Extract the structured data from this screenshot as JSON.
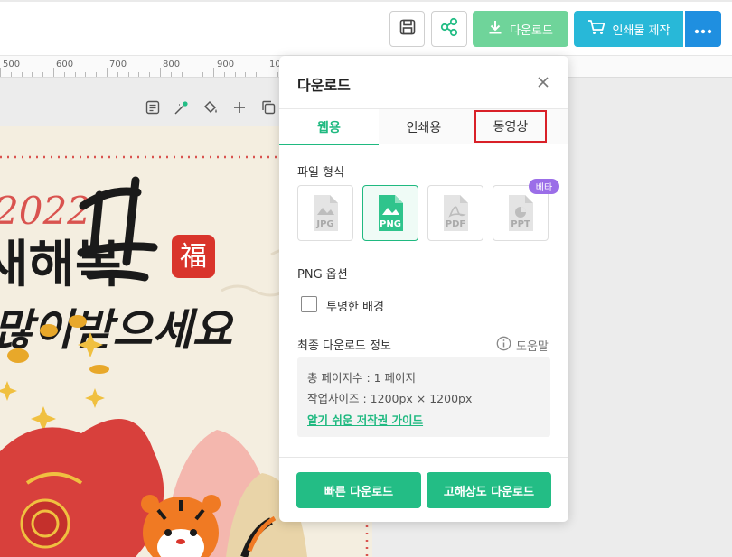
{
  "toolbar": {
    "download_label": "다운로드",
    "print_label": "인쇄물 제작",
    "more_icon": "more-icon"
  },
  "ruler": {
    "labels": [
      "500",
      "600",
      "700",
      "800",
      "900",
      "10"
    ]
  },
  "canvas": {
    "artwork_text": {
      "year": "2022",
      "line1": "새해복",
      "line2": "많이받으세요",
      "stamp": "福"
    }
  },
  "download_panel": {
    "title": "다운로드",
    "tabs": [
      {
        "label": "웹용",
        "active": true
      },
      {
        "label": "인쇄용",
        "active": false
      },
      {
        "label": "동영상",
        "active": false,
        "highlighted": true
      }
    ],
    "file_format_label": "파일 형식",
    "formats": [
      {
        "label": "JPG",
        "selected": false
      },
      {
        "label": "PNG",
        "selected": true
      },
      {
        "label": "PDF",
        "selected": false
      },
      {
        "label": "PPT",
        "selected": false,
        "badge": "베타"
      }
    ],
    "png_options_label": "PNG 옵션",
    "transparent_bg_label": "투명한 배경",
    "transparent_bg_checked": false,
    "final_info_label": "최종 다운로드 정보",
    "help_label": "도움말",
    "info_lines": [
      "총 페이지수 : 1 페이지",
      "작업사이즈 : 1200px × 1200px"
    ],
    "guide_link": "알기 쉬운 저작권 가이드",
    "fast_download": "빠른 다운로드",
    "hq_download": "고해상도 다운로드"
  },
  "colors": {
    "accent_green": "#1fb980",
    "button_green": "#23bd85",
    "download_btn": "#6fd49a",
    "print_btn": "#28b8d8",
    "more_btn": "#1f8fe0",
    "highlight_red": "#d92028",
    "beta_purple": "#9b6ee8"
  }
}
